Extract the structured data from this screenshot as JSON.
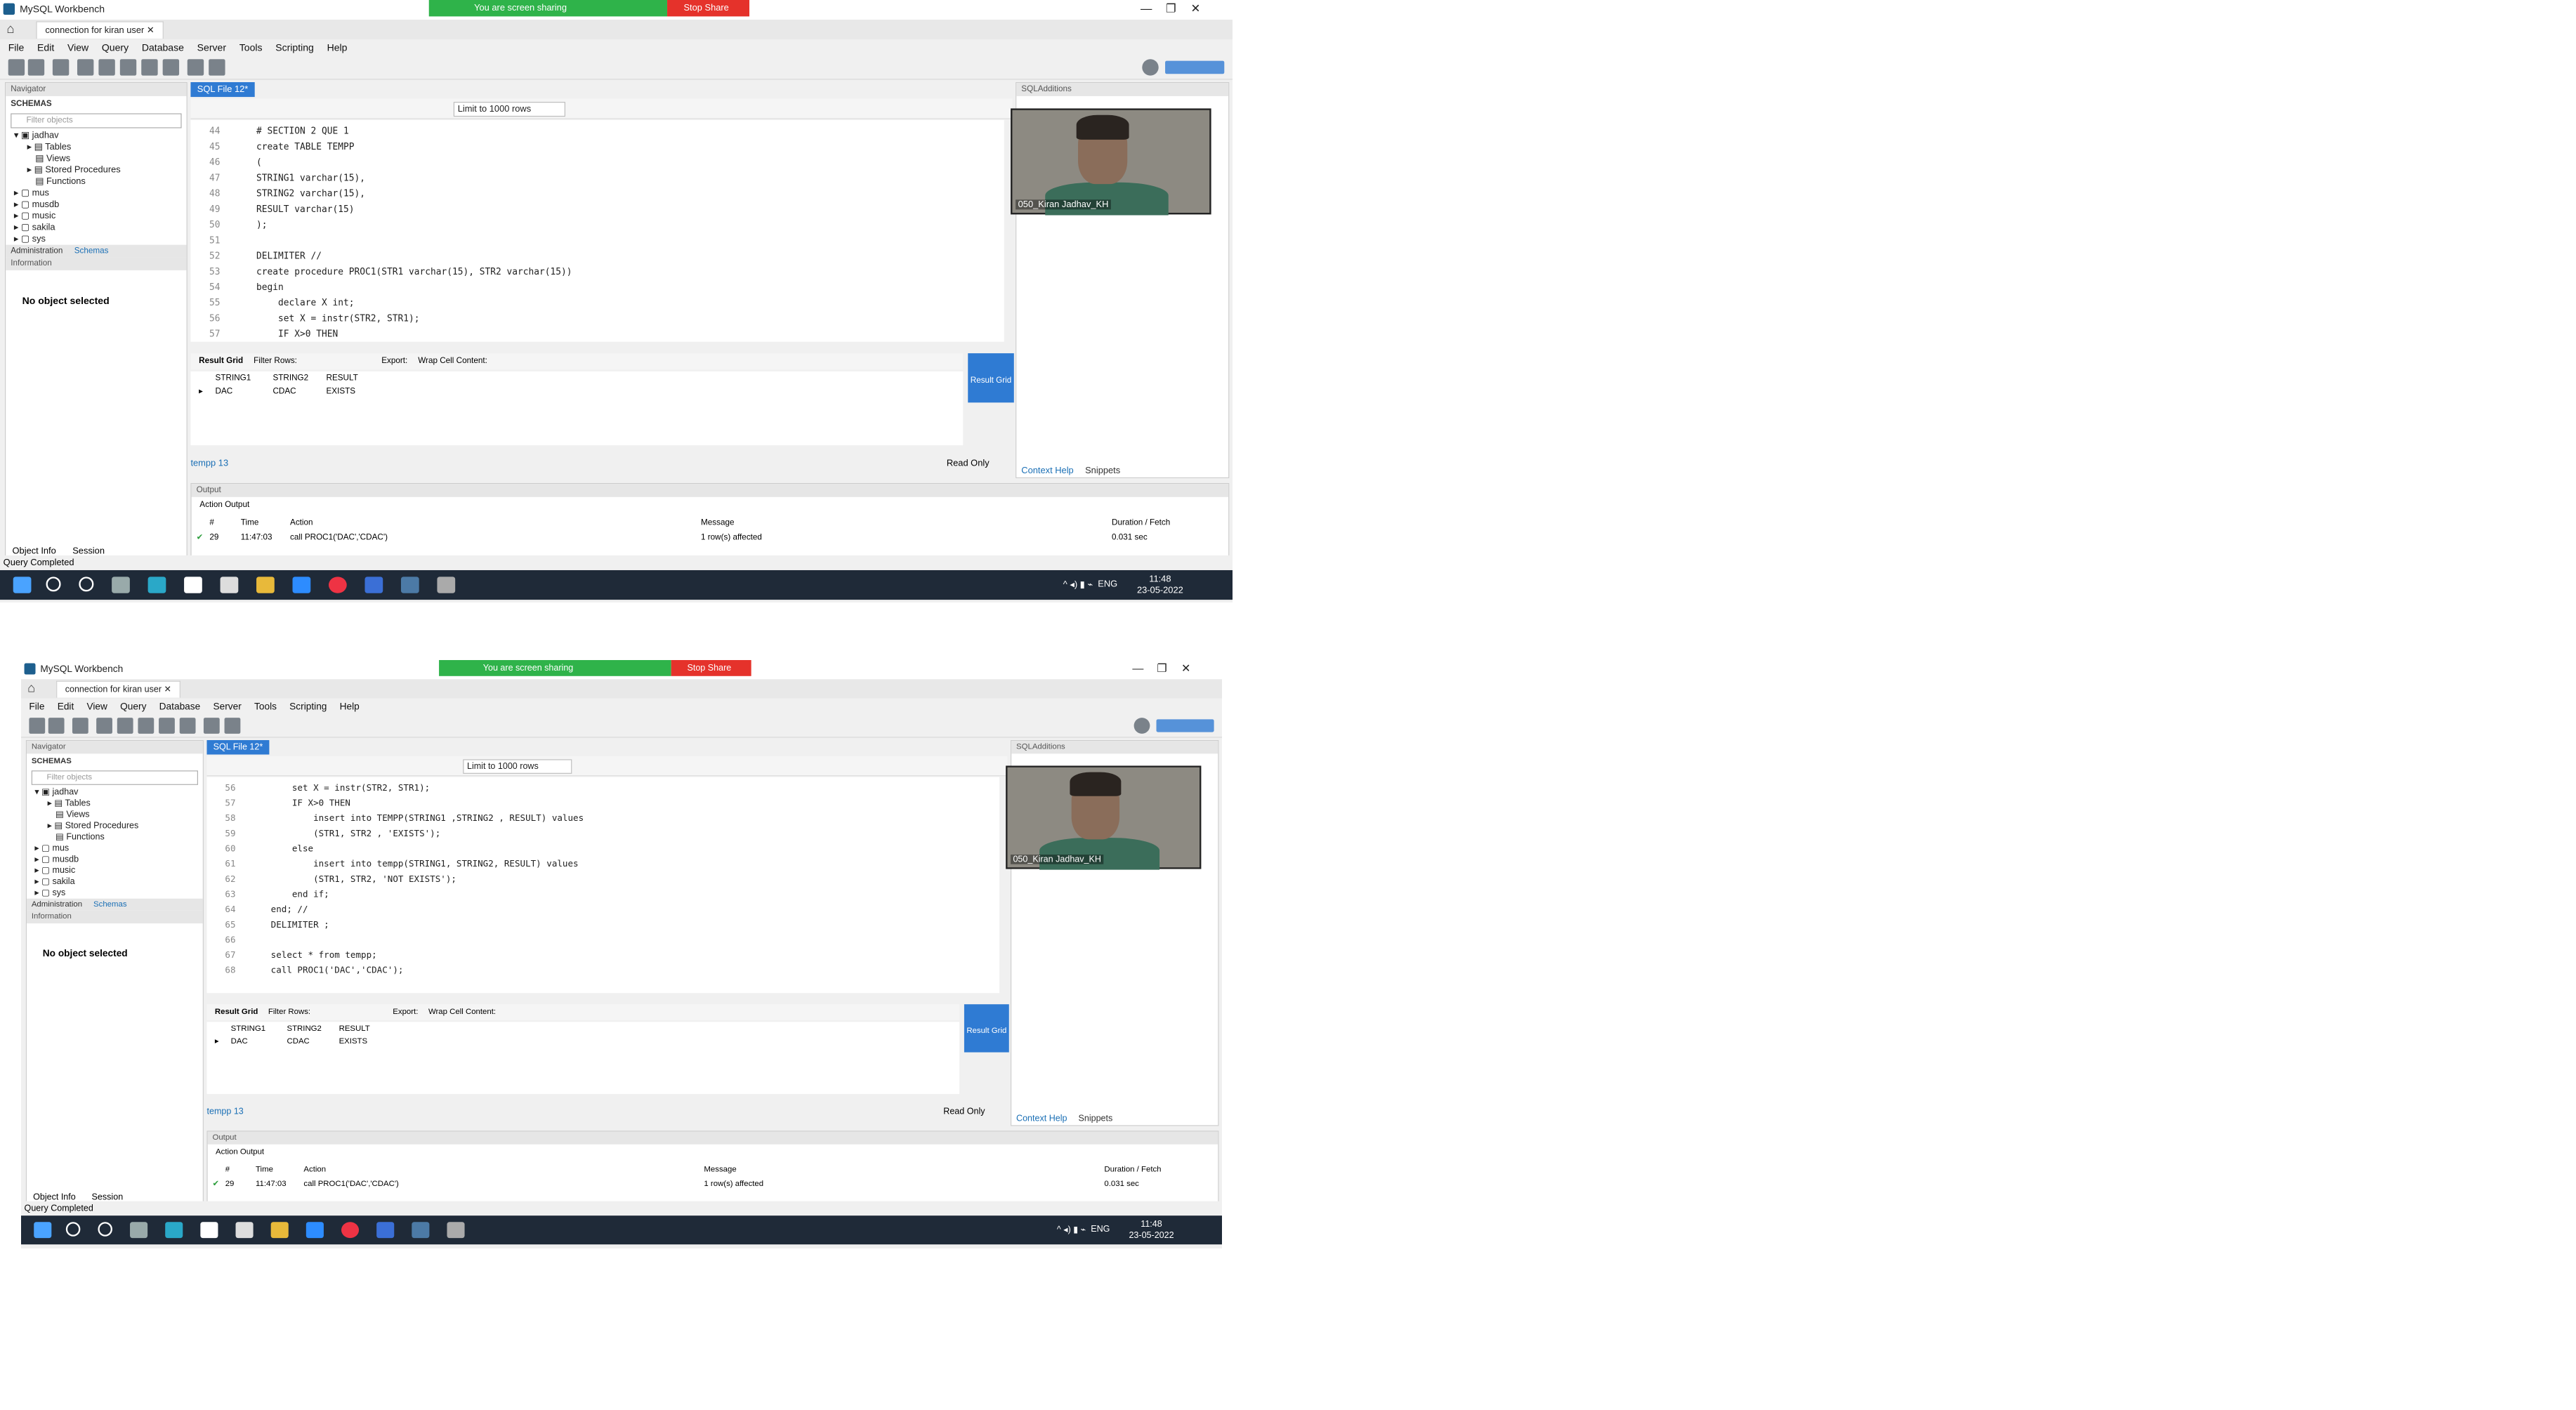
{
  "window": {
    "app_title": "MySQL Workbench",
    "connection_tab": "connection for kiran user",
    "minimize": "—",
    "restore": "❐",
    "close": "✕"
  },
  "screen_share": {
    "status": "You are screen sharing",
    "stop": "Stop Share"
  },
  "menu": [
    "File",
    "Edit",
    "View",
    "Query",
    "Database",
    "Server",
    "Tools",
    "Scripting",
    "Help"
  ],
  "navigator": {
    "header": "Navigator",
    "schemas_label": "SCHEMAS",
    "filter_placeholder": "Filter objects",
    "tree": [
      "jadhav",
      "Tables",
      "Views",
      "Stored Procedures",
      "Functions",
      "mus",
      "musdb",
      "music",
      "sakila",
      "sys"
    ],
    "tabs": [
      "Administration",
      "Schemas"
    ],
    "information_header": "Information",
    "no_object": "No object selected",
    "bottom_tabs": [
      "Object Info",
      "Session"
    ]
  },
  "editor": {
    "tab": "SQL File 12*",
    "limit": "Limit to 1000 rows",
    "lines_top": [
      {
        "n": "44",
        "text": "# SECTION 2 QUE 1"
      },
      {
        "n": "45",
        "text": "create TABLE TEMPP"
      },
      {
        "n": "46",
        "text": "("
      },
      {
        "n": "47",
        "text": "STRING1 varchar(15),"
      },
      {
        "n": "48",
        "text": "STRING2 varchar(15),"
      },
      {
        "n": "49",
        "text": "RESULT varchar(15)"
      },
      {
        "n": "50",
        "text": ");"
      },
      {
        "n": "51",
        "text": ""
      },
      {
        "n": "52",
        "text": "DELIMITER //"
      },
      {
        "n": "53",
        "text": "create procedure PROC1(STR1 varchar(15), STR2 varchar(15))"
      },
      {
        "n": "54",
        "text": "begin"
      },
      {
        "n": "55",
        "text": "    declare X int;"
      },
      {
        "n": "56",
        "text": "    set X = instr(STR2, STR1);"
      },
      {
        "n": "57",
        "text": "    IF X>0 THEN"
      }
    ],
    "lines_bottom": [
      {
        "n": "56",
        "text": "    set X = instr(STR2, STR1);"
      },
      {
        "n": "57",
        "text": "    IF X>0 THEN"
      },
      {
        "n": "58",
        "text": "        insert into TEMPP(STRING1 ,STRING2 , RESULT) values"
      },
      {
        "n": "59",
        "text": "        (STR1, STR2 , 'EXISTS');"
      },
      {
        "n": "60",
        "text": "    else"
      },
      {
        "n": "61",
        "text": "        insert into tempp(STRING1, STRING2, RESULT) values"
      },
      {
        "n": "62",
        "text": "        (STR1, STR2, 'NOT EXISTS');"
      },
      {
        "n": "63",
        "text": "    end if;"
      },
      {
        "n": "64",
        "text": "end; //"
      },
      {
        "n": "65",
        "text": "DELIMITER ;"
      },
      {
        "n": "66",
        "text": ""
      },
      {
        "n": "67",
        "text": "select * from tempp;"
      },
      {
        "n": "68",
        "text": "call PROC1('DAC','CDAC');"
      }
    ]
  },
  "results": {
    "bar": [
      "Result Grid",
      "Filter Rows:",
      "Export:",
      "Wrap Cell Content:"
    ],
    "columns": [
      "STRING1",
      "STRING2",
      "RESULT"
    ],
    "row": [
      "DAC",
      "CDAC",
      "EXISTS"
    ],
    "side_button": "Result Grid",
    "tab": "tempp 13",
    "read_only": "Read Only"
  },
  "right_panel": {
    "header": "SQLAdditions",
    "tabs": [
      "Context Help",
      "Snippets"
    ]
  },
  "video": {
    "name": "050_Kiran Jadhav_KH"
  },
  "output": {
    "header": "Output",
    "mode": "Action Output",
    "columns": [
      "#",
      "Time",
      "Action",
      "Message",
      "Duration / Fetch"
    ],
    "row": {
      "n": "29",
      "time": "11:47:03",
      "action": "call PROC1('DAC','CDAC')",
      "message": "1 row(s) affected",
      "duration": "0.031 sec"
    }
  },
  "status": "Query Completed",
  "taskbar": {
    "lang": "ENG",
    "time": "11:48",
    "date": "23-05-2022"
  }
}
